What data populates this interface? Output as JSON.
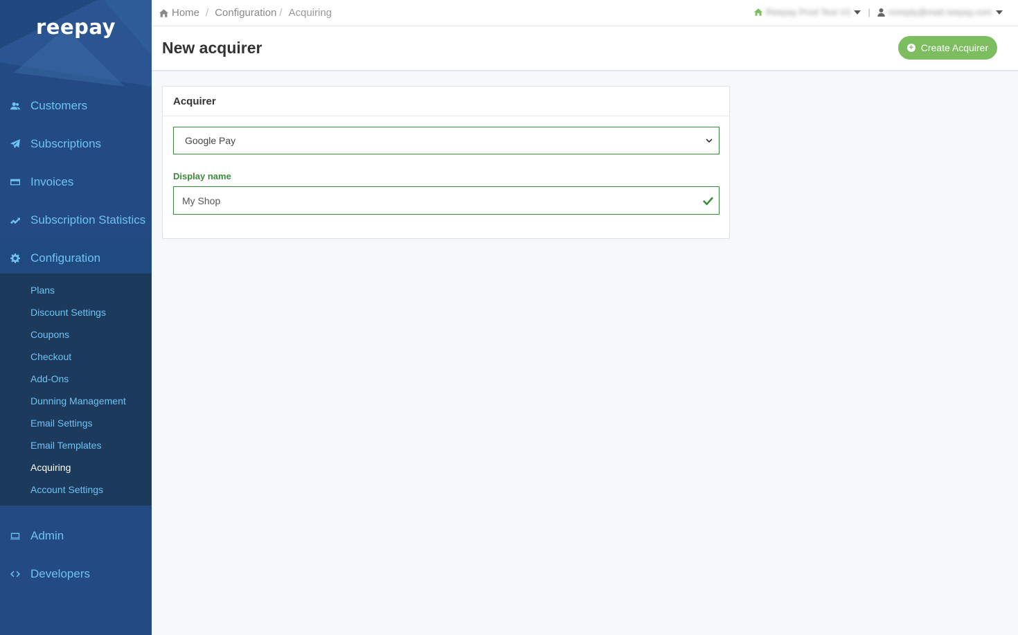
{
  "app": {
    "logo": "reepay"
  },
  "sidebar": {
    "items": [
      {
        "label": "Customers",
        "icon": "users-icon"
      },
      {
        "label": "Subscriptions",
        "icon": "paper-plane-icon"
      },
      {
        "label": "Invoices",
        "icon": "credit-card-icon"
      },
      {
        "label": "Subscription Statistics",
        "icon": "chart-line-icon"
      },
      {
        "label": "Configuration",
        "icon": "gear-icon"
      },
      {
        "label": "Admin",
        "icon": "monitor-icon"
      },
      {
        "label": "Developers",
        "icon": "code-icon"
      }
    ],
    "submenu": [
      {
        "label": "Plans"
      },
      {
        "label": "Discount Settings"
      },
      {
        "label": "Coupons"
      },
      {
        "label": "Checkout"
      },
      {
        "label": "Add-Ons"
      },
      {
        "label": "Dunning Management"
      },
      {
        "label": "Email Settings"
      },
      {
        "label": "Email Templates"
      },
      {
        "label": "Acquiring"
      },
      {
        "label": "Account Settings"
      }
    ]
  },
  "topbar": {
    "breadcrumb": [
      "Home",
      "Configuration",
      "Acquiring"
    ],
    "account_name": "Reepay Prod Test V2",
    "user_email": "noreply@mail.reepay.com",
    "separator": "|"
  },
  "header": {
    "title": "New acquirer",
    "create_label": "Create Acquirer"
  },
  "card": {
    "title": "Acquirer",
    "acquirer_selected": "Google Pay",
    "display_name_label": "Display name",
    "display_name_value": "My Shop"
  },
  "colors": {
    "sidebar": "#234a82",
    "submenu": "#1b3a5c",
    "link": "#6ec3f4",
    "success": "#3c8b3c",
    "button": "#7bbd5f"
  }
}
